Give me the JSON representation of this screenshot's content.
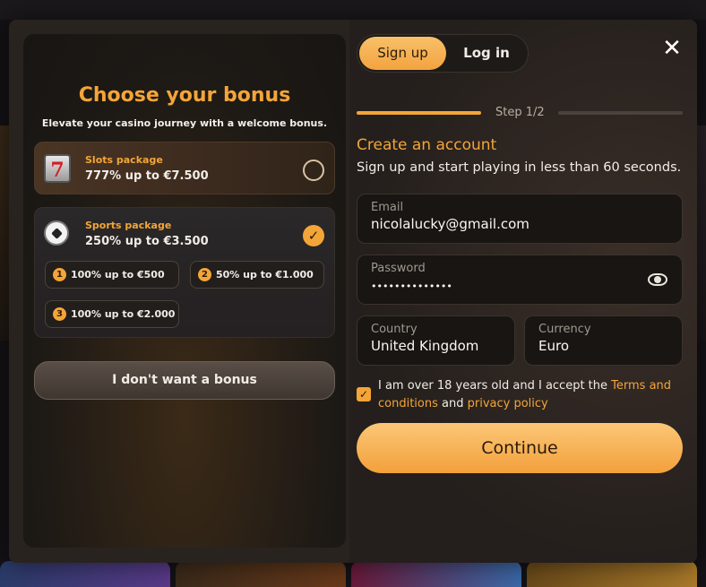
{
  "bonus": {
    "title": "Choose your bonus",
    "subtitle": "Elevate your casino journey with a welcome bonus.",
    "packages": [
      {
        "name": "Slots package",
        "value": "777% up to €7.500",
        "icon": "slot-machine-icon",
        "selected": false
      },
      {
        "name": "Sports package",
        "value": "250% up to €3.500",
        "icon": "soccer-ball-icon",
        "selected": true
      }
    ],
    "tiers": [
      {
        "num": "1",
        "label": "100% up to €500"
      },
      {
        "num": "2",
        "label": "50% up to €1.000"
      },
      {
        "num": "3",
        "label": "100% up to €2.000"
      }
    ],
    "no_bonus_label": "I don't want a bonus",
    "slot_icon_glyph": "7"
  },
  "auth": {
    "tabs": [
      {
        "label": "Sign up",
        "active": true
      },
      {
        "label": "Log in",
        "active": false
      }
    ],
    "close_glyph": "✕",
    "step_label": "Step 1/2",
    "create_title": "Create an account",
    "create_subtitle": "Sign up and start playing in less than 60 seconds.",
    "fields": {
      "email": {
        "label": "Email",
        "value": "nicolalucky@gmail.com"
      },
      "password": {
        "label": "Password",
        "value": "••••••••••••••"
      },
      "country": {
        "label": "Country",
        "value": "United Kingdom"
      },
      "currency": {
        "label": "Currency",
        "value": "Euro"
      }
    },
    "agree": {
      "checked": true,
      "text_start": "I am over 18 years old and I accept the ",
      "terms_link": "Terms and conditions",
      "text_mid": " and ",
      "privacy_link": "privacy policy"
    },
    "continue_label": "Continue"
  },
  "colors": {
    "accent": "#f4a538",
    "panel": "#28231f",
    "input_bg": "#181512"
  }
}
